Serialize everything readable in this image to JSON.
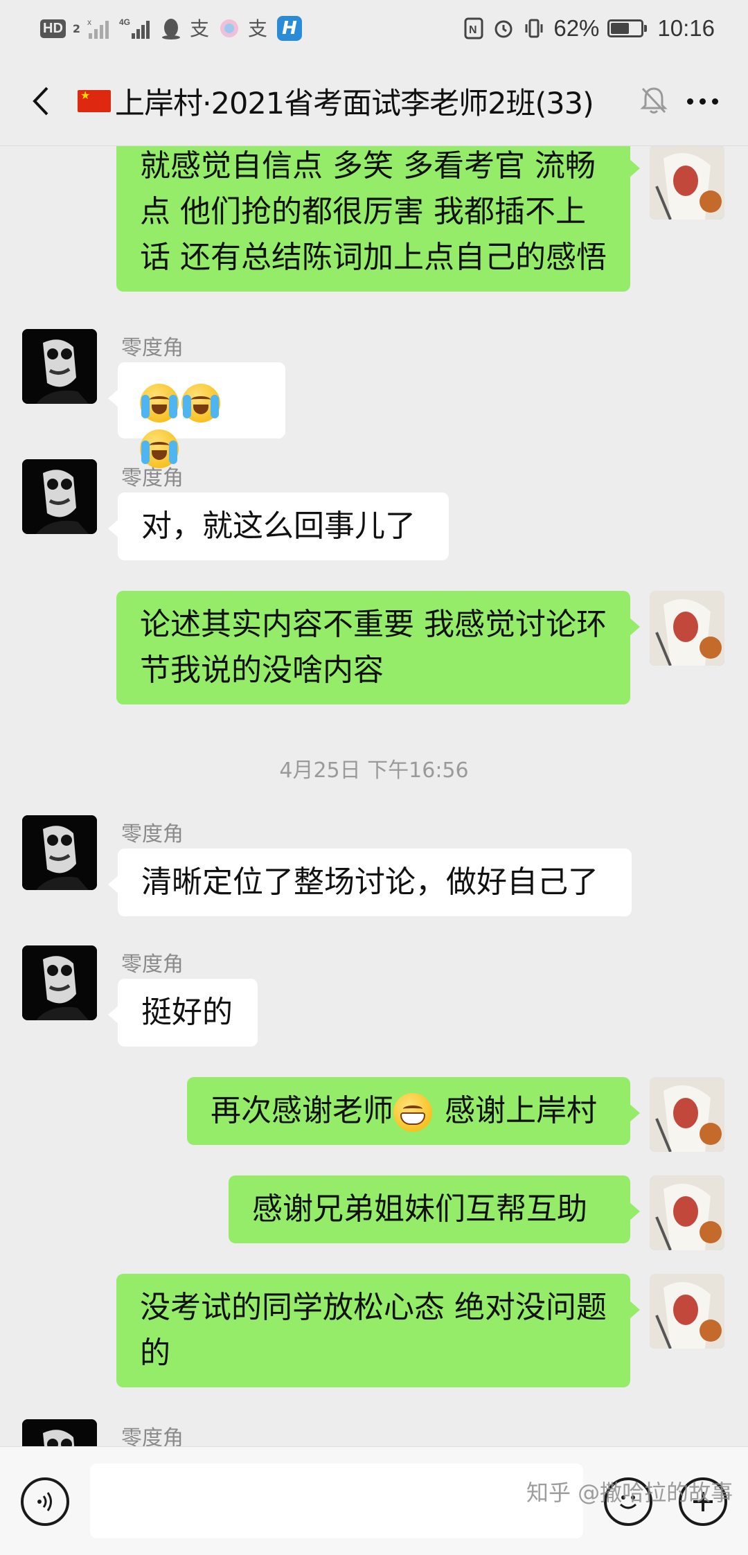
{
  "status_bar": {
    "hd_label": "HD",
    "hd_sub": "2",
    "network": "4G",
    "battery_text": "62%",
    "battery_level": 0.62,
    "time": "10:16"
  },
  "header": {
    "title": "上岸村·2021省考面试李老师2班(33)"
  },
  "messages": {
    "m1": {
      "text": "就感觉自信点 多笑 多看考官 流畅点 他们抢的都很厉害 我都插不上话 还有总结陈词加上点自己的感悟"
    },
    "m2": {
      "sender": "零度角"
    },
    "m3": {
      "sender": "零度角",
      "text": "对，就这么回事儿了"
    },
    "m4": {
      "text": "论述其实内容不重要 我感觉讨论环节我说的没啥内容"
    },
    "timestamp": "4月25日 下午16:56",
    "m5": {
      "sender": "零度角",
      "text": "清晰定位了整场讨论，做好自己了"
    },
    "m6": {
      "sender": "零度角",
      "text": "挺好的"
    },
    "m7": {
      "text_a": "再次感谢老师",
      "text_b": " 感谢上岸村"
    },
    "m8": {
      "text": "感谢兄弟姐妹们互帮互助"
    },
    "m9": {
      "text": "没考试的同学放松心态 绝对没问题的"
    },
    "m10": {
      "sender": "零度角"
    }
  },
  "input": {
    "placeholder": ""
  },
  "watermark": "知乎 @撒哈拉的故事",
  "colors": {
    "background": "#ededed",
    "outgoing_bubble": "#95ec69",
    "incoming_bubble": "#ffffff"
  }
}
